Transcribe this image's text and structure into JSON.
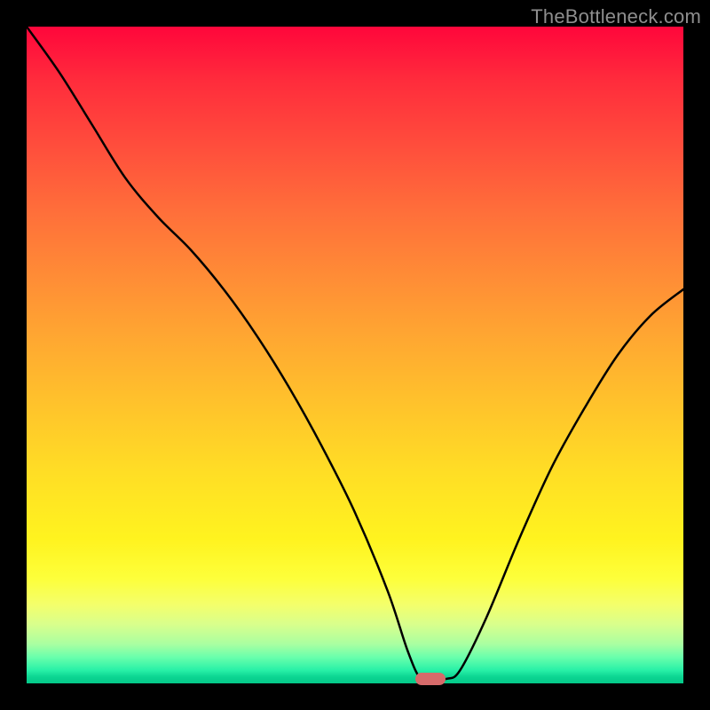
{
  "watermark_text": "TheBottleneck.com",
  "marker": {
    "x_pct": 61.5,
    "y_pct": 99.3
  },
  "chart_data": {
    "type": "line",
    "title": "",
    "xlabel": "",
    "ylabel": "",
    "xlim": [
      0,
      100
    ],
    "ylim": [
      0,
      100
    ],
    "series": [
      {
        "name": "bottleneck-curve",
        "x": [
          0,
          5,
          10,
          15,
          20,
          25,
          30,
          35,
          40,
          45,
          50,
          55,
          58,
          60,
          62,
          64,
          66,
          70,
          75,
          80,
          85,
          90,
          95,
          100
        ],
        "y": [
          100,
          93,
          85,
          77,
          71,
          66,
          60,
          53,
          45,
          36,
          26,
          14,
          5,
          0.7,
          0.7,
          0.7,
          2,
          10,
          22,
          33,
          42,
          50,
          56,
          60
        ]
      }
    ],
    "annotations": [
      {
        "name": "optimal-marker",
        "x": 61.5,
        "y": 0.7
      }
    ]
  }
}
